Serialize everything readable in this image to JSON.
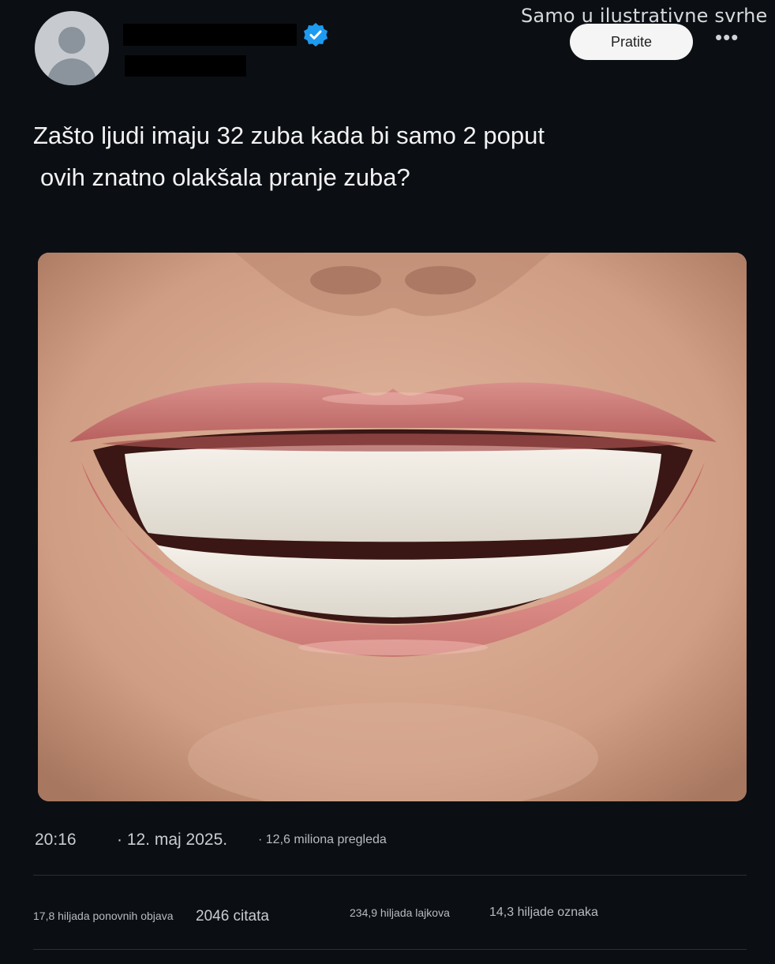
{
  "watermark": "Samo u ilustrativne svrhe",
  "header": {
    "follow_label": "Pratite",
    "more_label": "•••"
  },
  "post": {
    "text_line1": "Zašto ljudi imaju 32 zuba kada bi samo 2 poput",
    "text_line2": "ovih znatno olakšala pranje zuba?"
  },
  "meta": {
    "time": "20:16",
    "date": "· 12. maj 2025.",
    "views": "· 12,6 miliona pregleda"
  },
  "stats": {
    "reposts": "17,8 hiljada ponovnih objava",
    "quotes": "2046 citata",
    "likes": "234,9 hiljada lajkova",
    "bookmarks": "14,3 hiljade oznaka"
  },
  "colors": {
    "background": "#0b0f14",
    "verified": "#1d9bf0",
    "follow_button": "#f5f5f5"
  },
  "icons": [
    "default-avatar-icon",
    "verified-badge-icon",
    "more-options-icon"
  ]
}
